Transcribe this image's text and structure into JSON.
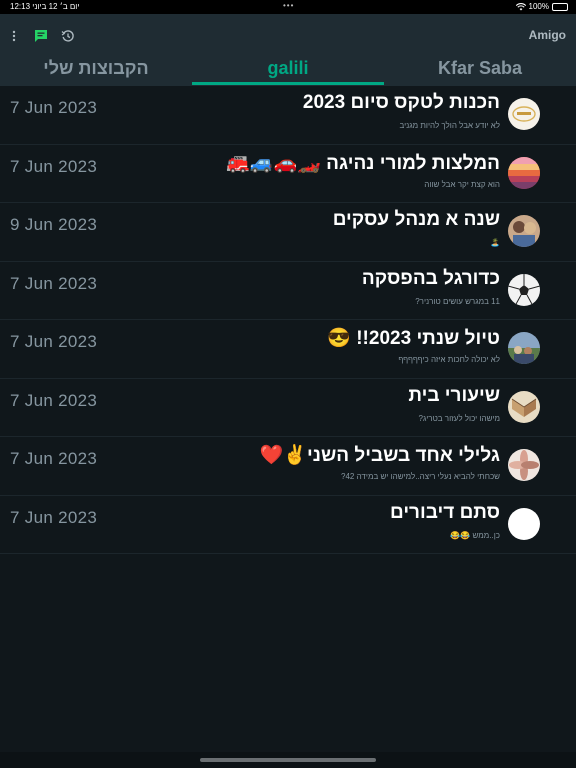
{
  "status_bar": {
    "time_date": "12:13 יום ב׳ 12 ביוני",
    "battery": "100%",
    "battery_level": 1.0
  },
  "header": {
    "app_title": "Amigo",
    "icons": [
      "more-vert-icon",
      "chat-icon",
      "history-icon"
    ]
  },
  "tabs": [
    {
      "label": "Kfar Saba",
      "active": false
    },
    {
      "label": "galili",
      "active": true
    },
    {
      "label": "הקבוצות שלי",
      "active": false
    }
  ],
  "chats": [
    {
      "name": "הכנות לטקס סיום 2023",
      "preview": "לא יודע אבל הולך להיות מגניב",
      "date": "7 Jun 2023",
      "avatar": "logo-avatar"
    },
    {
      "name": "המלצות למורי נהיגה 🏎️🚗🚙🚒",
      "preview": "הוא קצת יקר אבל שווה",
      "date": "7 Jun 2023",
      "avatar": "balloon-avatar"
    },
    {
      "name": "שנה א מנהל עסקים",
      "preview": "🏝️",
      "date": "9 Jun 2023",
      "avatar": "people-avatar"
    },
    {
      "name": "כדורגל בהפסקה",
      "preview": "11 במגרש עושים טורניר?",
      "date": "7 Jun 2023",
      "avatar": "soccer-ball-avatar"
    },
    {
      "name": "טיול שנתי 2023!! 😎",
      "preview": "לא יכולה לחכות איזה כיףףףףף",
      "date": "7 Jun 2023",
      "avatar": "trip-avatar"
    },
    {
      "name": "שיעורי בית",
      "preview": "מישהו יכול לעזור בטריג?",
      "date": "7 Jun 2023",
      "avatar": "book-avatar"
    },
    {
      "name": "גלילי אחד בשביל השני✌️❤️",
      "preview": "שכחתי להביא נעלי ריצה..למישהו יש במידה 42?",
      "date": "7 Jun 2023",
      "avatar": "hands-avatar"
    },
    {
      "name": "סתם דיבורים",
      "preview": "כן..ממש 😂😂",
      "date": "7 Jun 2023",
      "avatar": "blank-avatar"
    }
  ]
}
